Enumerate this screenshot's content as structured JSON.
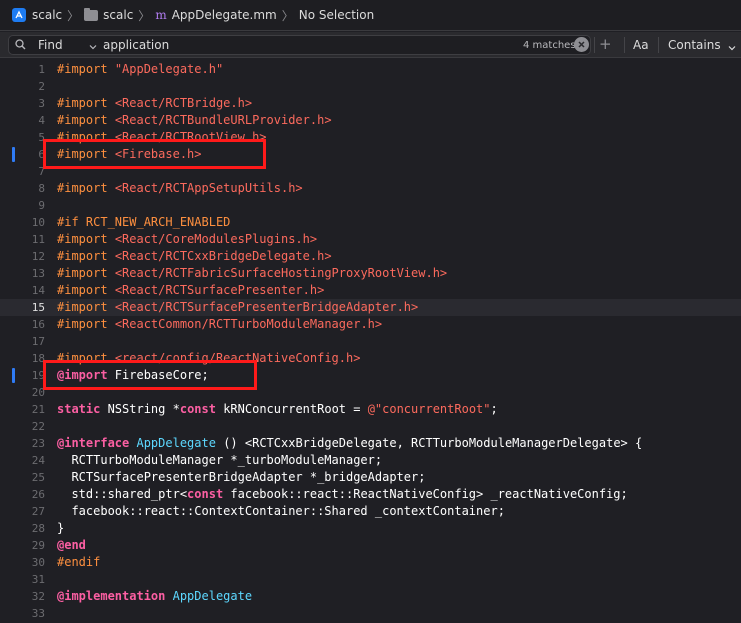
{
  "jumpbar": {
    "crumbs": [
      {
        "label": "scalc",
        "icon": "xcode-app-icon"
      },
      {
        "label": "scalc",
        "icon": "folder-icon"
      },
      {
        "label": "AppDelegate.mm",
        "icon": "objc-m-file-icon",
        "badge": "m"
      },
      {
        "label": "No Selection"
      }
    ]
  },
  "find": {
    "mode": "Find",
    "query": "application",
    "match_count": "4 matches",
    "case_label": "Aa",
    "match_type": "Contains"
  },
  "colors": {
    "keyword": "#fc5fa3",
    "preprocessor": "#fd8f3f",
    "string": "#fc6a5d",
    "type": "#5dd8ff",
    "plain": "#ffffff",
    "change_marker": "#2f7bf5",
    "annotation_box": "#ff1a1a"
  },
  "editor": {
    "current_line": 15,
    "changed_lines": [
      6,
      19
    ],
    "highlighted_lines": [
      6,
      19
    ],
    "lines": [
      {
        "n": "1",
        "tokens": [
          {
            "t": "#import",
            "c": "pp"
          },
          {
            "t": " ",
            "c": "plain"
          },
          {
            "t": "\"AppDelegate.h\"",
            "c": "str"
          }
        ]
      },
      {
        "n": "2",
        "tokens": []
      },
      {
        "n": "3",
        "tokens": [
          {
            "t": "#import",
            "c": "pp"
          },
          {
            "t": " ",
            "c": "plain"
          },
          {
            "t": "<React/RCTBridge.h>",
            "c": "str"
          }
        ]
      },
      {
        "n": "4",
        "tokens": [
          {
            "t": "#import",
            "c": "pp"
          },
          {
            "t": " ",
            "c": "plain"
          },
          {
            "t": "<React/RCTBundleURLProvider.h>",
            "c": "str"
          }
        ]
      },
      {
        "n": "5",
        "tokens": [
          {
            "t": "#import",
            "c": "pp"
          },
          {
            "t": " ",
            "c": "plain"
          },
          {
            "t": "<React/RCTRootView.h>",
            "c": "str"
          }
        ]
      },
      {
        "n": "6",
        "tokens": [
          {
            "t": "#import",
            "c": "pp"
          },
          {
            "t": " ",
            "c": "plain"
          },
          {
            "t": "<Firebase.h>",
            "c": "str"
          }
        ]
      },
      {
        "n": "7",
        "tokens": []
      },
      {
        "n": "8",
        "tokens": [
          {
            "t": "#import",
            "c": "pp"
          },
          {
            "t": " ",
            "c": "plain"
          },
          {
            "t": "<React/RCTAppSetupUtils.h>",
            "c": "str"
          }
        ]
      },
      {
        "n": "9",
        "tokens": []
      },
      {
        "n": "10",
        "tokens": [
          {
            "t": "#if RCT_NEW_ARCH_ENABLED",
            "c": "pp"
          }
        ]
      },
      {
        "n": "11",
        "tokens": [
          {
            "t": "#import",
            "c": "pp"
          },
          {
            "t": " ",
            "c": "plain"
          },
          {
            "t": "<React/CoreModulesPlugins.h>",
            "c": "str"
          }
        ]
      },
      {
        "n": "12",
        "tokens": [
          {
            "t": "#import",
            "c": "pp"
          },
          {
            "t": " ",
            "c": "plain"
          },
          {
            "t": "<React/RCTCxxBridgeDelegate.h>",
            "c": "str"
          }
        ]
      },
      {
        "n": "13",
        "tokens": [
          {
            "t": "#import",
            "c": "pp"
          },
          {
            "t": " ",
            "c": "plain"
          },
          {
            "t": "<React/RCTFabricSurfaceHostingProxyRootView.h>",
            "c": "str"
          }
        ]
      },
      {
        "n": "14",
        "tokens": [
          {
            "t": "#import",
            "c": "pp"
          },
          {
            "t": " ",
            "c": "plain"
          },
          {
            "t": "<React/RCTSurfacePresenter.h>",
            "c": "str"
          }
        ]
      },
      {
        "n": "15",
        "tokens": [
          {
            "t": "#import",
            "c": "pp"
          },
          {
            "t": " ",
            "c": "plain"
          },
          {
            "t": "<React/RCTSurfacePresenterBridgeAdapter.h>",
            "c": "str"
          }
        ]
      },
      {
        "n": "16",
        "tokens": [
          {
            "t": "#import",
            "c": "pp"
          },
          {
            "t": " ",
            "c": "plain"
          },
          {
            "t": "<ReactCommon/RCTTurboModuleManager.h>",
            "c": "str"
          }
        ]
      },
      {
        "n": "17",
        "tokens": []
      },
      {
        "n": "18",
        "tokens": [
          {
            "t": "#import",
            "c": "pp"
          },
          {
            "t": " ",
            "c": "plain"
          },
          {
            "t": "<react/config/ReactNativeConfig.h>",
            "c": "str"
          }
        ]
      },
      {
        "n": "19",
        "tokens": [
          {
            "t": "@import",
            "c": "kw"
          },
          {
            "t": " FirebaseCore;",
            "c": "plain"
          }
        ]
      },
      {
        "n": "20",
        "tokens": []
      },
      {
        "n": "21",
        "tokens": [
          {
            "t": "static",
            "c": "kw"
          },
          {
            "t": " NSString *",
            "c": "plain"
          },
          {
            "t": "const",
            "c": "kw"
          },
          {
            "t": " kRNConcurrentRoot = ",
            "c": "plain"
          },
          {
            "t": "@\"concurrentRoot\"",
            "c": "str"
          },
          {
            "t": ";",
            "c": "plain"
          }
        ]
      },
      {
        "n": "22",
        "tokens": []
      },
      {
        "n": "23",
        "tokens": [
          {
            "t": "@interface",
            "c": "kw"
          },
          {
            "t": " ",
            "c": "plain"
          },
          {
            "t": "AppDelegate",
            "c": "type"
          },
          {
            "t": " () <RCTCxxBridgeDelegate, RCTTurboModuleManagerDelegate> {",
            "c": "plain"
          }
        ]
      },
      {
        "n": "24",
        "tokens": [
          {
            "t": "  RCTTurboModuleManager *_turboModuleManager;",
            "c": "plain"
          }
        ]
      },
      {
        "n": "25",
        "tokens": [
          {
            "t": "  RCTSurfacePresenterBridgeAdapter *_bridgeAdapter;",
            "c": "plain"
          }
        ]
      },
      {
        "n": "26",
        "tokens": [
          {
            "t": "  std::shared_ptr<",
            "c": "plain"
          },
          {
            "t": "const",
            "c": "kw"
          },
          {
            "t": " facebook::react::ReactNativeConfig> _reactNativeConfig;",
            "c": "plain"
          }
        ]
      },
      {
        "n": "27",
        "tokens": [
          {
            "t": "  facebook::react::ContextContainer::Shared _contextContainer;",
            "c": "plain"
          }
        ]
      },
      {
        "n": "28",
        "tokens": [
          {
            "t": "}",
            "c": "plain"
          }
        ]
      },
      {
        "n": "29",
        "tokens": [
          {
            "t": "@end",
            "c": "kw"
          }
        ]
      },
      {
        "n": "30",
        "tokens": [
          {
            "t": "#endif",
            "c": "pp"
          }
        ]
      },
      {
        "n": "31",
        "tokens": []
      },
      {
        "n": "32",
        "tokens": [
          {
            "t": "@implementation",
            "c": "kw"
          },
          {
            "t": " ",
            "c": "plain"
          },
          {
            "t": "AppDelegate",
            "c": "type"
          }
        ]
      },
      {
        "n": "33",
        "tokens": []
      }
    ]
  }
}
